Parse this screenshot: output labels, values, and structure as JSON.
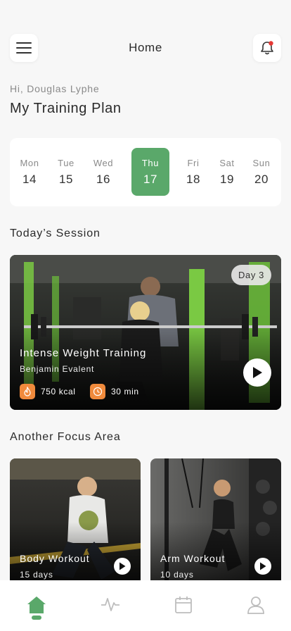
{
  "header": {
    "title": "Home",
    "menu_icon": "hamburger-menu-icon",
    "bell_icon": "notification-bell-icon",
    "notification_color": "#e53935"
  },
  "greeting": "Hi, Douglas Lyphe",
  "plan_title": "My Training Plan",
  "week": {
    "selected_index": 3,
    "accent": "#5aa86a",
    "days": [
      {
        "name": "Mon",
        "num": "14"
      },
      {
        "name": "Tue",
        "num": "15"
      },
      {
        "name": "Wed",
        "num": "16"
      },
      {
        "name": "Thu",
        "num": "17"
      },
      {
        "name": "Fri",
        "num": "18"
      },
      {
        "name": "Sat",
        "num": "19"
      },
      {
        "name": "Sun",
        "num": "20"
      }
    ]
  },
  "session": {
    "section_title": "Today’s Session",
    "badge": "Day 3",
    "name": "Intense Weight Training",
    "coach": "Benjamin Evalent",
    "kcal": "750 kcal",
    "duration": "30 min",
    "stat_color": "#f08a3c"
  },
  "focus": {
    "section_title": "Another Focus Area",
    "cards": [
      {
        "name": "Body Workout",
        "days": "15 days"
      },
      {
        "name": "Arm Workout",
        "days": "10 days"
      }
    ]
  },
  "nav": {
    "items": [
      "home-icon",
      "activity-icon",
      "calendar-icon",
      "profile-icon"
    ],
    "active_index": 0
  }
}
